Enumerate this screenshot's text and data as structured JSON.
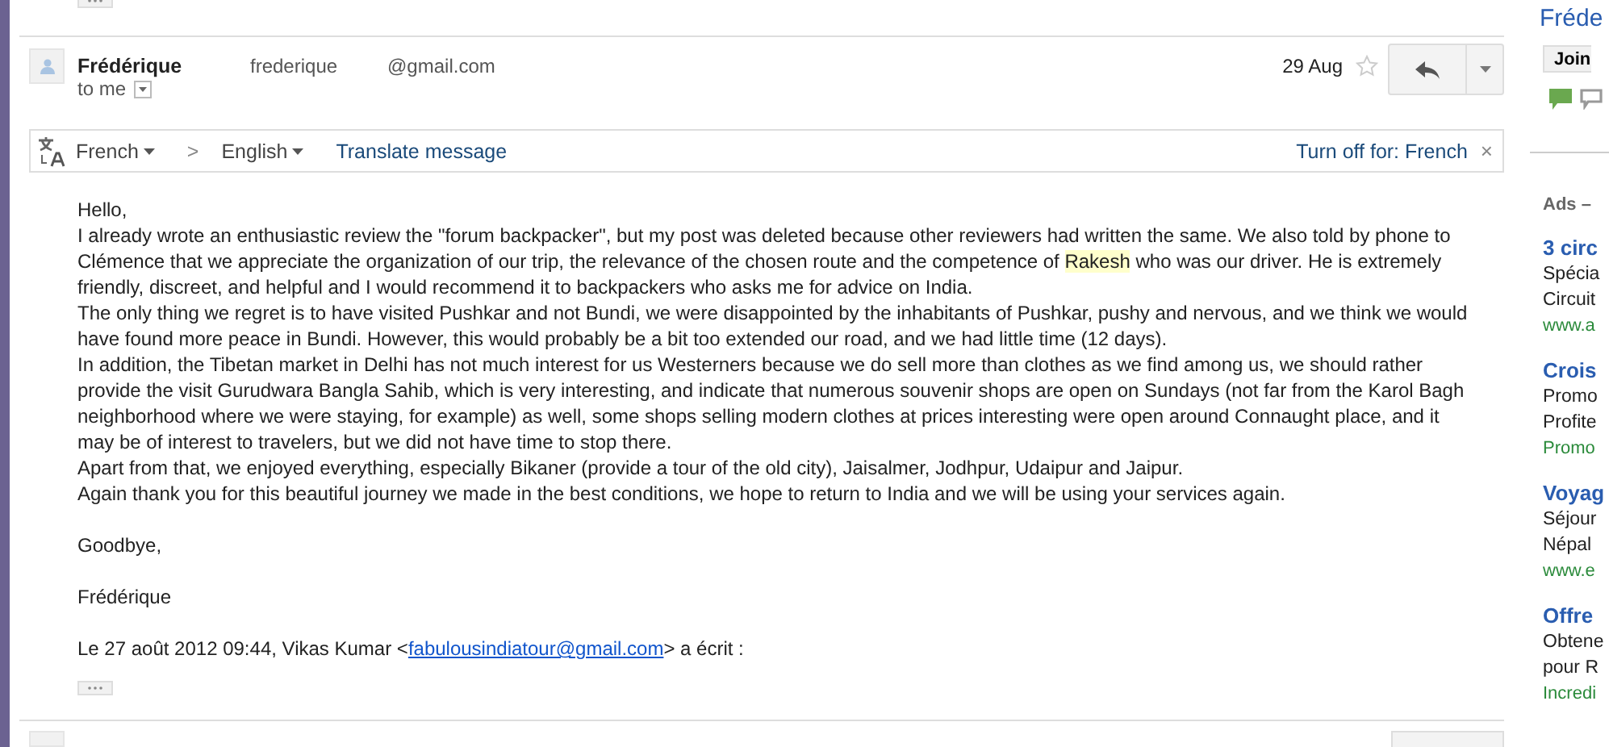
{
  "message": {
    "sender_name": "Frédérique",
    "sender_user": "frederique",
    "sender_domain": "@gmail.com",
    "recipient": "to me",
    "date": "29 Aug",
    "starred": false
  },
  "translate_bar": {
    "source": "French",
    "arrow": ">",
    "target": "English",
    "action": "Translate message",
    "turn_off": "Turn off for: French",
    "close": "×"
  },
  "body": {
    "blocks": [
      [
        {
          "segments": [
            {
              "text": "Hello,",
              "highlighted": false
            }
          ]
        },
        {
          "segments": [
            {
              "text": "I already wrote an enthusiastic review the \"forum backpacker\", but my post was deleted because other reviewers had written the same. We also told by phone to Clémence that we appreciate the organization of our trip, the relevance of the chosen route and the competence of ",
              "highlighted": false
            },
            {
              "text": "Rakesh",
              "highlighted": true
            },
            {
              "text": " who was our driver. He is extremely friendly, discreet, and helpful and I would recommend it to backpackers who asks me for advice on India.",
              "highlighted": false
            }
          ]
        },
        {
          "segments": [
            {
              "text": "The only thing we regret is to have visited Pushkar and not Bundi, we were disappointed by the inhabitants of Pushkar, pushy and nervous, and we think we would have found more peace in Bundi. However, this would probably be a bit too extended our road, and we had little time (12 days).",
              "highlighted": false
            }
          ]
        },
        {
          "segments": [
            {
              "text": "In addition, the Tibetan market in Delhi has not much interest for us Westerners because we do sell more than clothes as we find among us, we should rather provide the visit Gurudwara Bangla Sahib, which is very interesting, and indicate that numerous souvenir shops are open on Sundays (not far from the Karol Bagh neighborhood where we were staying, for example) as well, some shops selling modern clothes at prices interesting were open around Connaught place, and it may be of interest to travelers, but we did not have time to stop there.",
              "highlighted": false
            }
          ]
        },
        {
          "segments": [
            {
              "text": "Apart from that, we enjoyed everything, especially Bikaner (provide a tour of the old city), Jaisalmer, Jodhpur, Udaipur and Jaipur.",
              "highlighted": false
            }
          ]
        },
        {
          "segments": [
            {
              "text": "Again thank you for this beautiful journey we made in the best conditions, we hope to return to India and we will be using your services again.",
              "highlighted": false
            }
          ]
        }
      ],
      [
        {
          "segments": [
            {
              "text": "Goodbye,",
              "highlighted": false
            }
          ]
        }
      ],
      [
        {
          "segments": [
            {
              "text": "Frédérique",
              "highlighted": false
            }
          ]
        }
      ]
    ],
    "quote": {
      "before": "Le 27 août 2012 09:44, Vikas Kumar <",
      "link": "fabulousindiatour@gmail.com",
      "after": "> a écrit :"
    }
  },
  "sidebar": {
    "contact_name": "Fréde",
    "join_button": "Join",
    "ads_label": "Ads –",
    "ads": [
      {
        "title": "3 circ",
        "lines": [
          "Spécia",
          "Circuit"
        ],
        "url": "www.a"
      },
      {
        "title": "Crois",
        "lines": [
          "Promo",
          "Profite"
        ],
        "url": "Promo"
      },
      {
        "title": "Voyag",
        "lines": [
          "Séjour",
          "Népal"
        ],
        "url": "www.e"
      },
      {
        "title": "Offre",
        "lines": [
          "Obtene",
          "pour R"
        ],
        "url": "Incredi"
      }
    ]
  }
}
